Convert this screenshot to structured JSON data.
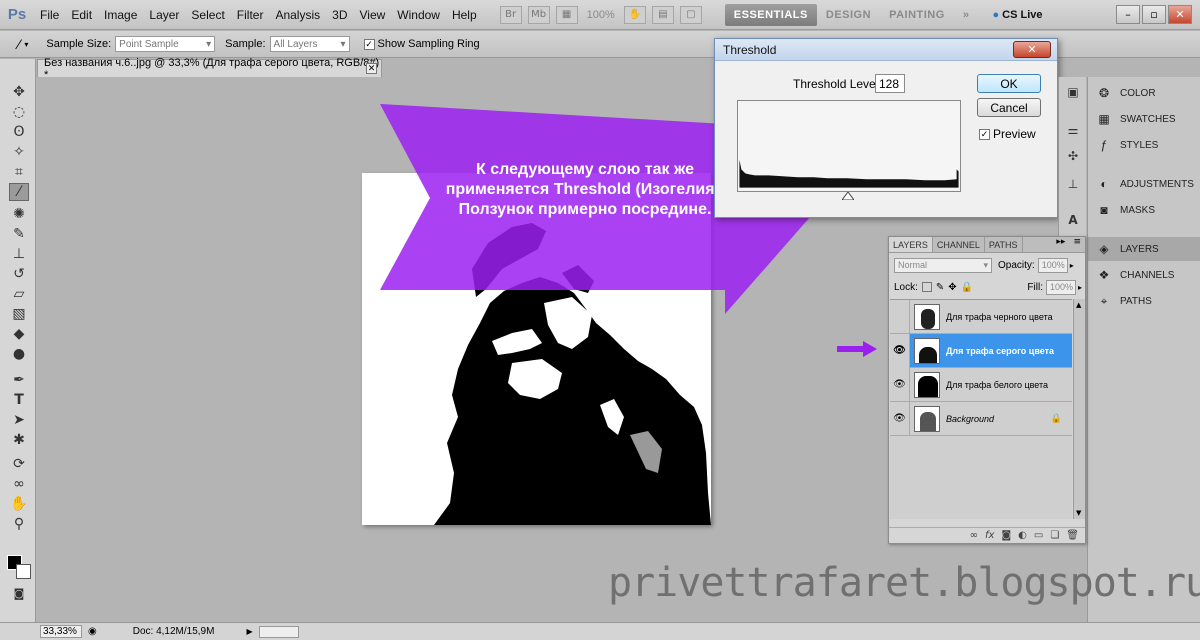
{
  "app": {
    "logo": "Ps"
  },
  "menu": [
    "File",
    "Edit",
    "Image",
    "Layer",
    "Select",
    "Filter",
    "Analysis",
    "3D",
    "View",
    "Window",
    "Help"
  ],
  "toolbar_icons": {
    "bridge": "Br",
    "mini_bridge": "Mb",
    "zoom_level": "100%"
  },
  "workspaces": {
    "essentials": "ESSENTIALS",
    "design": "DESIGN",
    "painting": "PAINTING",
    "more": "»"
  },
  "cs_live": "CS Live",
  "options_bar": {
    "sample_size_label": "Sample Size:",
    "sample_size_value": "Point Sample",
    "sample_label": "Sample:",
    "sample_value": "All Layers",
    "show_sampling_ring": "Show Sampling Ring"
  },
  "document": {
    "tab_title": "Без названия ч.6..jpg @ 33,3% (Для трафа серого цвета, RGB/8#) *"
  },
  "annotation": {
    "caption": "К следующему слою так же применяется Threshold (Изогелия). Ползунок примерно посредине.",
    "color": "#9b20f0"
  },
  "threshold_dialog": {
    "title": "Threshold",
    "level_label": "Threshold Level:",
    "level_value": "128",
    "ok": "OK",
    "cancel": "Cancel",
    "preview": "Preview"
  },
  "dock": {
    "color": "COLOR",
    "swatches": "SWATCHES",
    "styles": "STYLES",
    "adjustments": "ADJUSTMENTS",
    "masks": "MASKS",
    "layers": "LAYERS",
    "channels": "CHANNELS",
    "paths": "PATHS"
  },
  "layers_panel": {
    "tabs": [
      "LAYERS",
      "CHANNEL",
      "PATHS"
    ],
    "blend_mode": "Normal",
    "opacity_label": "Opacity:",
    "opacity_value": "100%",
    "lock_label": "Lock:",
    "fill_label": "Fill:",
    "fill_value": "100%",
    "layers": [
      {
        "name": "Для трафа черного цвета",
        "visible": false,
        "selected": false
      },
      {
        "name": "Для трафа серого цвета",
        "visible": true,
        "selected": true
      },
      {
        "name": "Для трафа белого цвета",
        "visible": true,
        "selected": false
      },
      {
        "name": "Background",
        "visible": true,
        "selected": false
      }
    ]
  },
  "status": {
    "zoom": "33,33%",
    "doc": "Doc: 4,12M/15,9M"
  },
  "watermark": "privettrafaret.blogspot.ru"
}
